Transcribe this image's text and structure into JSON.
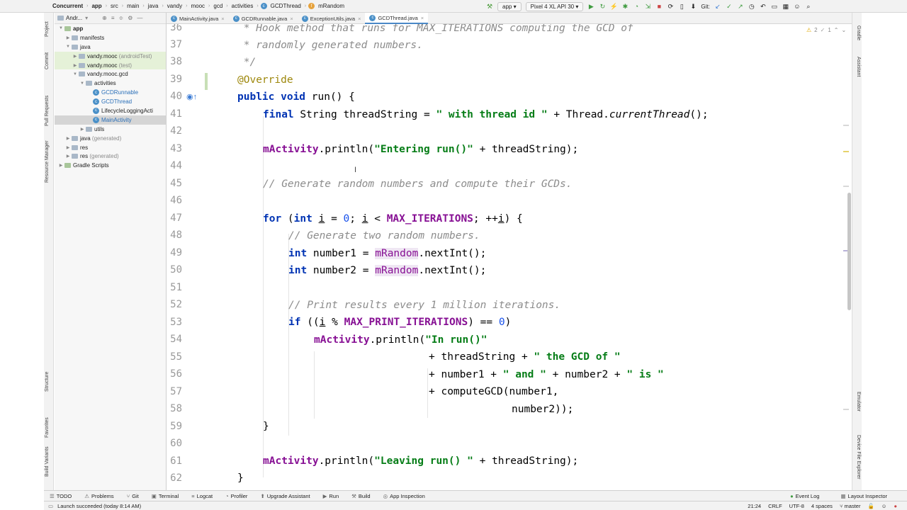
{
  "nav": {
    "breadcrumbs": [
      "Concurrent",
      "app",
      "src",
      "main",
      "java",
      "vandy",
      "mooc",
      "gcd",
      "activities",
      "GCDThread",
      "mRandom"
    ],
    "run_config": "app",
    "device": "Pixel 4 XL API 30",
    "git_label": "Git:"
  },
  "left_strip": [
    "Project",
    "Commit",
    "Pull Requests",
    "Resource Manager",
    "Structure",
    "Favorites",
    "Build Variants"
  ],
  "right_strip": [
    "Gradle",
    "Assistant",
    "Emulator",
    "Device File Explorer"
  ],
  "project": {
    "header": "Andr...",
    "items": [
      {
        "label": "app",
        "suffix": ""
      },
      {
        "label": "manifests",
        "suffix": ""
      },
      {
        "label": "java",
        "suffix": ""
      },
      {
        "label": "vandy.mooc",
        "suffix": "(androidTest)"
      },
      {
        "label": "vandy.mooc",
        "suffix": "(test)"
      },
      {
        "label": "vandy.mooc.gcd",
        "suffix": ""
      },
      {
        "label": "activities",
        "suffix": ""
      },
      {
        "label": "GCDRunnable",
        "suffix": ""
      },
      {
        "label": "GCDThread",
        "suffix": ""
      },
      {
        "label": "LifecycleLoggingActi",
        "suffix": ""
      },
      {
        "label": "MainActivity",
        "suffix": ""
      },
      {
        "label": "utils",
        "suffix": ""
      },
      {
        "label": "java",
        "suffix": "(generated)"
      },
      {
        "label": "res",
        "suffix": ""
      },
      {
        "label": "res",
        "suffix": "(generated)"
      },
      {
        "label": "Gradle Scripts",
        "suffix": ""
      }
    ]
  },
  "tabs": [
    "MainActivity.java",
    "GCDRunnable.java",
    "ExceptionUtils.java",
    "GCDThread.java"
  ],
  "inspection": {
    "warnings": "2",
    "weak": "1"
  },
  "line_numbers": [
    "36",
    "37",
    "38",
    "39",
    "40",
    "41",
    "42",
    "43",
    "44",
    "45",
    "46",
    "47",
    "48",
    "49",
    "50",
    "51",
    "52",
    "53",
    "54",
    "55",
    "56",
    "57",
    "58",
    "59",
    "60",
    "61",
    "62"
  ],
  "bottom_tools": [
    "TODO",
    "Problems",
    "Git",
    "Terminal",
    "Logcat",
    "Profiler",
    "Upgrade Assistant",
    "Run",
    "Build",
    "App Inspection"
  ],
  "bottom_right": [
    "Event Log",
    "Layout Inspector"
  ],
  "status": {
    "message": "Launch succeeded (today 8:14 AM)",
    "position": "21:24",
    "line_sep": "CRLF",
    "encoding": "UTF-8",
    "indent": "4 spaces",
    "branch": "master"
  }
}
